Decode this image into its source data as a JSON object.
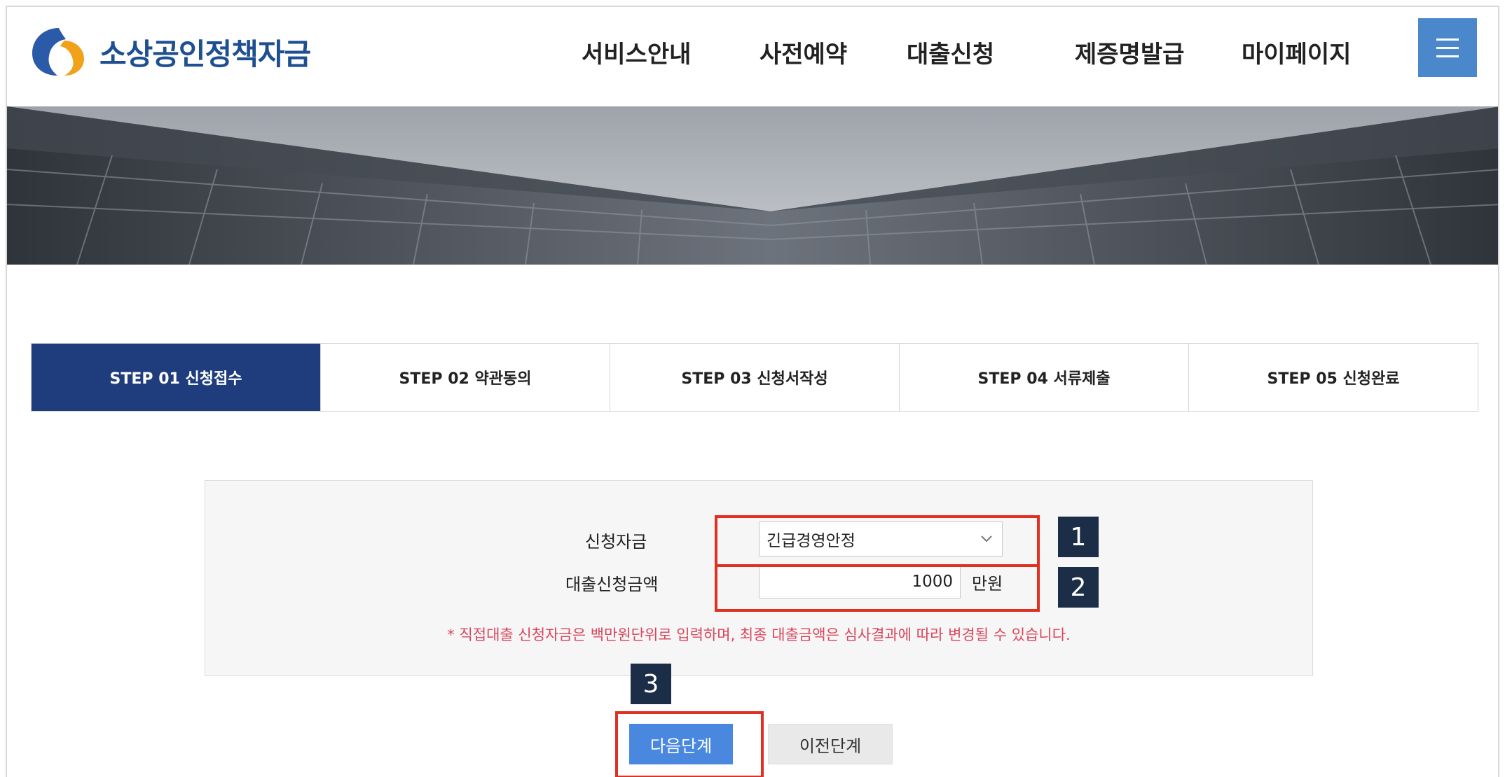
{
  "brand": {
    "name": "소상공인정책자금",
    "colors": {
      "primary": "#1d4f91",
      "accent": "#4a88cb",
      "step_active": "#1f3d7d",
      "highlight": "#e03022",
      "notice": "#d8465c"
    }
  },
  "nav": {
    "items": [
      "서비스안내",
      "사전예약",
      "대출신청",
      "제증명발급",
      "마이페이지"
    ],
    "menu_icon": "hamburger-icon"
  },
  "steps": [
    {
      "label": "STEP 01 신청접수",
      "active": true
    },
    {
      "label": "STEP 02 약관동의",
      "active": false
    },
    {
      "label": "STEP 03 신청서작성",
      "active": false
    },
    {
      "label": "STEP 04 서류제출",
      "active": false
    },
    {
      "label": "STEP 05 신청완료",
      "active": false
    }
  ],
  "form": {
    "fund_label": "신청자금",
    "fund_value": "긴급경영안정",
    "amount_label": "대출신청금액",
    "amount_value": "1000",
    "amount_unit": "만원",
    "notice": "* 직접대출 신청자금은 백만원단위로 입력하며, 최종 대출금액은 심사결과에 따라 변경될 수 있습니다."
  },
  "buttons": {
    "next": "다음단계",
    "prev": "이전단계"
  },
  "markers": [
    "1",
    "2",
    "3"
  ]
}
